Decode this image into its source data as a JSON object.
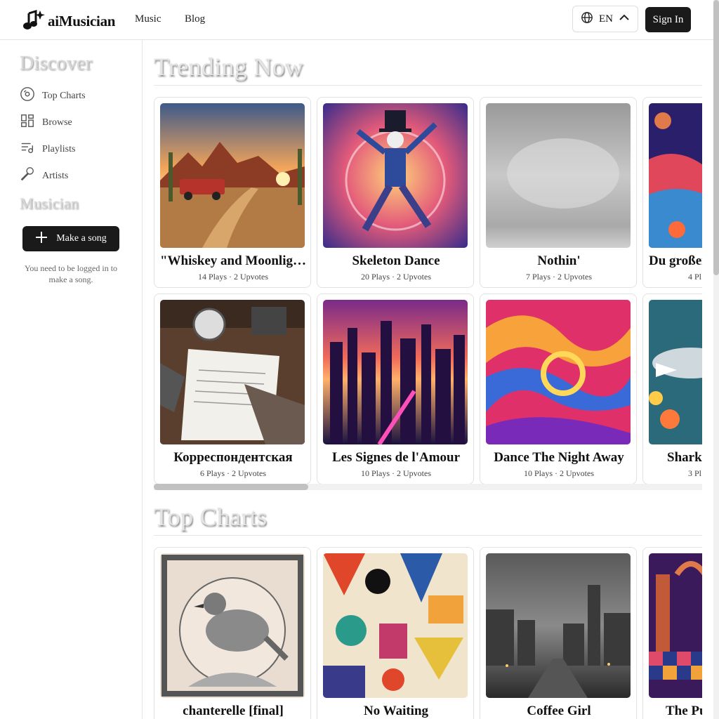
{
  "header": {
    "brand": "aiMusician",
    "nav": [
      "Music",
      "Blog"
    ],
    "language": "EN",
    "sign_in": "Sign In"
  },
  "sidebar": {
    "discover_heading": "Discover",
    "items": [
      {
        "label": "Top Charts",
        "icon": "disc-icon"
      },
      {
        "label": "Browse",
        "icon": "grid-icon"
      },
      {
        "label": "Playlists",
        "icon": "playlist-icon"
      },
      {
        "label": "Artists",
        "icon": "microphone-icon"
      }
    ],
    "musician_heading": "Musician",
    "make_song": "Make a song",
    "login_note": "You need to be logged in to make a song."
  },
  "trending": {
    "title": "Trending Now",
    "cards": [
      {
        "title": "\"Whiskey and Moonlig…",
        "meta": "14 Plays · 2 Upvotes"
      },
      {
        "title": "Skeleton Dance",
        "meta": "20 Plays · 2 Upvotes"
      },
      {
        "title": "Nothin'",
        "meta": "7 Plays · 2 Upvotes"
      },
      {
        "title": "Du großer",
        "meta": "4 Pl"
      },
      {
        "title": "Корреспондентская",
        "meta": "6 Plays · 2 Upvotes"
      },
      {
        "title": "Les Signes de l'Amour",
        "meta": "10 Plays · 2 Upvotes"
      },
      {
        "title": "Dance The Night Away",
        "meta": "10 Plays · 2 Upvotes"
      },
      {
        "title": "Shark'",
        "meta": "3 Pl"
      }
    ]
  },
  "top_charts": {
    "title": "Top Charts",
    "cards": [
      {
        "title": "chanterelle [final]"
      },
      {
        "title": "No Waiting"
      },
      {
        "title": "Coffee Girl"
      },
      {
        "title": "The Pu"
      }
    ]
  },
  "colors": {
    "accent": "#1a1a1a",
    "border": "#e2e2e2"
  }
}
